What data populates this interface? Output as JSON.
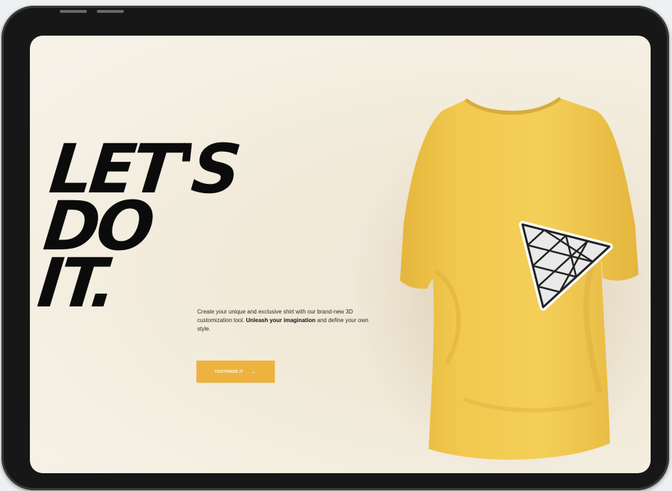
{
  "hero": {
    "headline": [
      "LET'S",
      "DO",
      "IT."
    ],
    "description_intro": "Create your unique and exclusive shirt with our brand-new 3D customization tool. ",
    "description_bold": "Unleash your imagination",
    "description_outro": " and define your own style.",
    "cta_label": "CUSTOMIZE IT",
    "cta_icon": "arrow-right-icon"
  },
  "colors": {
    "accent": "#edb33e",
    "shirt": "#f2c94c",
    "background": "#f3ede1",
    "headline": "#0b0b0b"
  },
  "shirt_graphic": {
    "icon": "triangle-grid-logo"
  }
}
